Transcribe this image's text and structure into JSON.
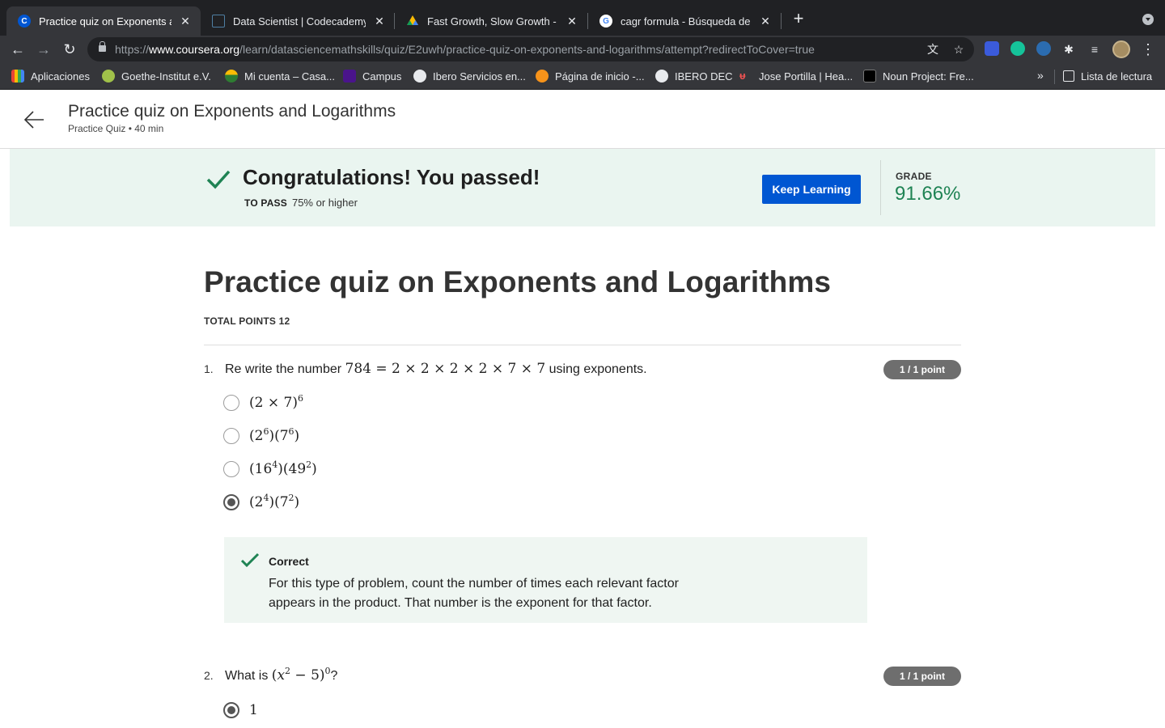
{
  "browser": {
    "tabs": [
      {
        "title": "Practice quiz on Exponents and Logarithms",
        "active": true,
        "favicon": "coursera-icon",
        "color": "#0056d2"
      },
      {
        "title": "Data Scientist | Codecademy",
        "active": false,
        "favicon": "codecademy-icon",
        "color": "#1f4056"
      },
      {
        "title": "Fast Growth, Slow Growth - Google Drive",
        "active": false,
        "favicon": "drive-icon",
        "color": "#fbbc04"
      },
      {
        "title": "cagr formula - Búsqueda de Google",
        "active": false,
        "favicon": "google-icon",
        "color": "#ffffff"
      }
    ],
    "url_prefix": "https://",
    "url_host": "www.coursera.org",
    "url_path": "/learn/datasciencemathskills/quiz/E2uwh/practice-quiz-on-exponents-and-logarithms/attempt?redirectToCover=true",
    "bookmarks": [
      {
        "label": "Aplicaciones",
        "icon": "apps-grid-icon",
        "color": "#e37400"
      },
      {
        "label": "Goethe-Institut e.V.",
        "icon": "goethe-icon",
        "color": "#a0c14a"
      },
      {
        "label": "Mi cuenta – Casa...",
        "icon": "casa-icon",
        "color": "#2e7d32"
      },
      {
        "label": "Campus",
        "icon": "campus-icon",
        "color": "#6a1b9a"
      },
      {
        "label": "Ibero Servicios en...",
        "icon": "globe-icon",
        "color": "#e8eaed"
      },
      {
        "label": "Página de inicio -...",
        "icon": "bitcoin-icon",
        "color": "#f7931a"
      },
      {
        "label": "IBERO DEC",
        "icon": "globe-icon",
        "color": "#e8eaed"
      },
      {
        "label": "Jose Portilla | Hea...",
        "icon": "udemy-icon",
        "color": "#ec5252"
      },
      {
        "label": "Noun Project: Fre...",
        "icon": "noun-project-icon",
        "color": "#000000"
      }
    ],
    "more_bookmarks": "»",
    "reading_list": "Lista de lectura"
  },
  "header": {
    "title": "Practice quiz on Exponents and Logarithms",
    "subtitle": "Practice Quiz • 40 min"
  },
  "banner": {
    "title": "Congratulations! You passed!",
    "to_pass_label": "TO PASS",
    "to_pass_value": "75% or higher",
    "button": "Keep Learning",
    "grade_label": "GRADE",
    "grade_value": "91.66%",
    "accent": "#1f8354",
    "button_color": "#0056d2"
  },
  "quiz": {
    "title": "Practice quiz on Exponents and Logarithms",
    "total_points": "TOTAL POINTS 12",
    "questions": [
      {
        "number": "1.",
        "text_before": "Re write the number",
        "math": "784 = 2 × 2 × 2 × 2 × 7 × 7",
        "text_after": "using exponents.",
        "points": "1 / 1 point",
        "options": [
          "(2 × 7)^6",
          "(2^6)(7^6)",
          "(16^4)(49^2)",
          "(2^4)(7^2)"
        ],
        "selected_index": 3,
        "feedback_title": "Correct",
        "feedback_text": "For this type of problem, count the number of times each relevant factor appears in the product. That number is the exponent for that factor."
      },
      {
        "number": "2.",
        "text_before": "What is",
        "math": "(x^2 − 5)^0",
        "text_after": "?",
        "points": "1 / 1 point",
        "options": [
          "1"
        ],
        "selected_index": 0
      }
    ]
  }
}
